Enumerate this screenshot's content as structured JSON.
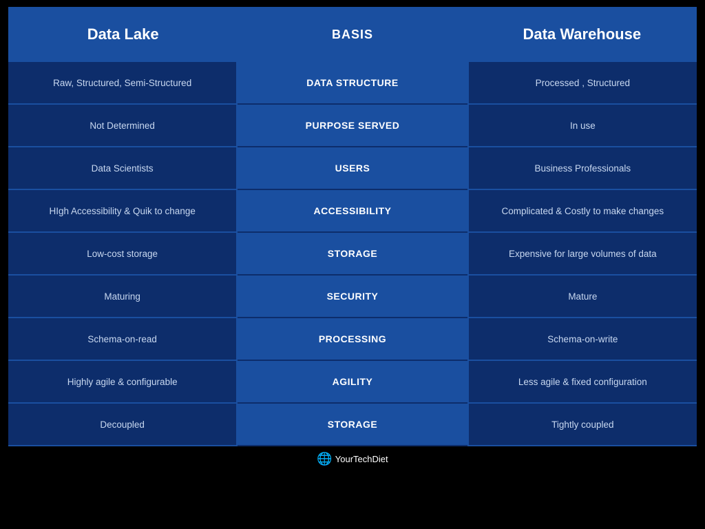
{
  "header": {
    "left_title": "Data Lake",
    "center_title": "BASIS",
    "right_title": "Data Warehouse"
  },
  "rows": [
    {
      "left": "Raw, Structured, Semi-Structured",
      "center": "DATA STRUCTURE",
      "right": "Processed , Structured"
    },
    {
      "left": "Not Determined",
      "center": "PURPOSE SERVED",
      "right": "In use"
    },
    {
      "left": "Data Scientists",
      "center": "USERS",
      "right": "Business Professionals"
    },
    {
      "left": "HIgh Accessibility & Quik to change",
      "center": "ACCESSIBILITY",
      "right": "Complicated & Costly to make changes"
    },
    {
      "left": "Low-cost storage",
      "center": "STORAGE",
      "right": "Expensive for large volumes of data"
    },
    {
      "left": "Maturing",
      "center": "SECURITY",
      "right": "Mature"
    },
    {
      "left": "Schema-on-read",
      "center": "PROCESSING",
      "right": "Schema-on-write"
    },
    {
      "left": "Highly agile & configurable",
      "center": "AGILITY",
      "right": "Less agile & fixed configuration"
    },
    {
      "left": "Decoupled",
      "center": "STORAGE",
      "right": "Tightly coupled"
    }
  ],
  "footer": {
    "brand": "YourTechDiet"
  }
}
